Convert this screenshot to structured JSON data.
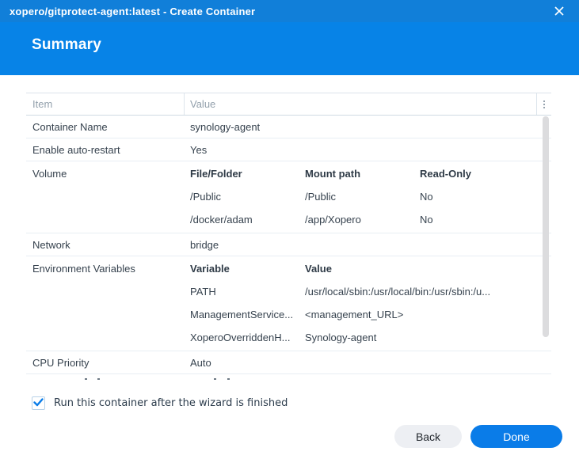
{
  "titlebar": {
    "title": "xopero/gitprotect-agent:latest - Create Container"
  },
  "header": {
    "title": "Summary"
  },
  "table": {
    "columns": {
      "item": "Item",
      "value": "Value"
    },
    "rows": {
      "container_name": {
        "label": "Container Name",
        "value": "synology-agent"
      },
      "auto_restart": {
        "label": "Enable auto-restart",
        "value": "Yes"
      },
      "volume": {
        "label": "Volume",
        "headers": {
          "file": "File/Folder",
          "mount": "Mount path",
          "readonly": "Read-Only"
        },
        "entries": [
          {
            "file": "/Public",
            "mount": "/Public",
            "readonly": "No"
          },
          {
            "file": "/docker/adam",
            "mount": "/app/Xopero",
            "readonly": "No"
          }
        ]
      },
      "network": {
        "label": "Network",
        "value": "bridge"
      },
      "env": {
        "label": "Environment Variables",
        "headers": {
          "variable": "Variable",
          "value": "Value"
        },
        "entries": [
          {
            "variable": "PATH",
            "value": "/usr/local/sbin:/usr/local/bin:/usr/sbin:/u..."
          },
          {
            "variable": "ManagementService...",
            "value": "<management_URL>"
          },
          {
            "variable": "XoperoOverriddenH...",
            "value": "Synology-agent"
          }
        ]
      },
      "cpu": {
        "label": "CPU Priority",
        "value": "Auto"
      }
    }
  },
  "checkbox": {
    "label": "Run this container after the wizard is finished",
    "checked": true
  },
  "footer": {
    "back_label": "Back",
    "done_label": "Done"
  },
  "colors": {
    "titlebar_blue": "#117fd9",
    "header_blue": "#0783e7",
    "accent_blue": "#0a7ce8"
  }
}
